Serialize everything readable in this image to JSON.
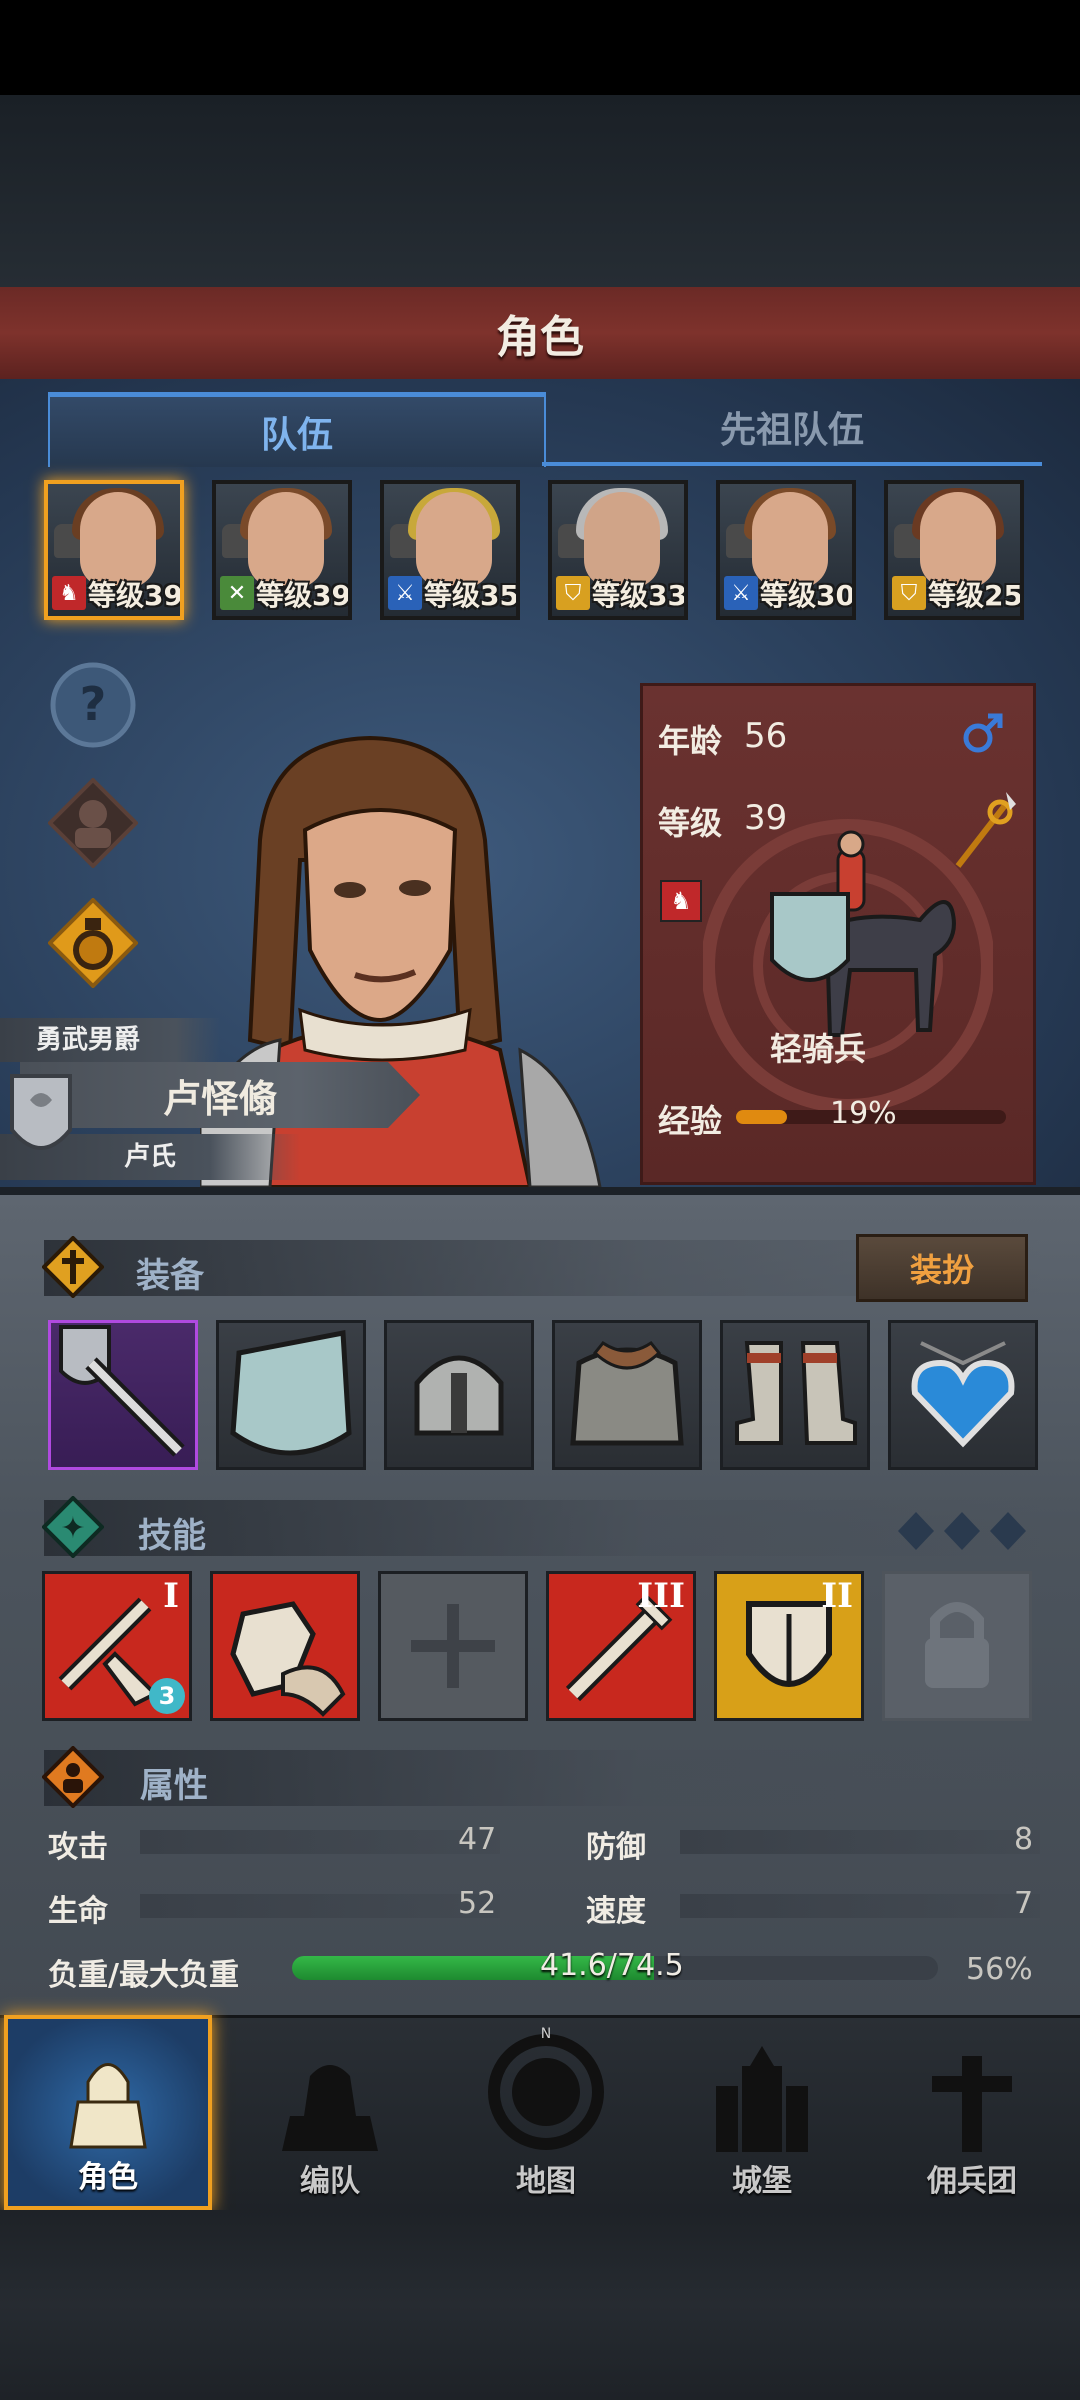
{
  "header": {
    "title": "角色"
  },
  "tabs": [
    {
      "label": "队伍",
      "active": true
    },
    {
      "label": "先祖队伍",
      "active": false
    }
  ],
  "heroes": [
    {
      "level": "等级39",
      "class_icon": "cavalry-icon",
      "badge_color": "#c0282a",
      "hair": "#6a3e22",
      "selected": true
    },
    {
      "level": "等级39",
      "class_icon": "crossed-swords-icon",
      "badge_color": "#4a8a3a",
      "hair": "#7a4a2a",
      "selected": false
    },
    {
      "level": "等级35",
      "class_icon": "sword-icon",
      "badge_color": "#2a62b8",
      "hair": "#c8a83a",
      "selected": false
    },
    {
      "level": "等级33",
      "class_icon": "shield-icon",
      "badge_color": "#d8a020",
      "hair": "#b8b8b8",
      "selected": false
    },
    {
      "level": "等级30",
      "class_icon": "sword-icon",
      "badge_color": "#2a62b8",
      "hair": "#7a4a28",
      "selected": false
    },
    {
      "level": "等级25",
      "class_icon": "shield-icon",
      "badge_color": "#d8a020",
      "hair": "#6a3a22",
      "selected": false
    }
  ],
  "side_buttons": [
    "help-icon",
    "helmet-icon",
    "potion-icon"
  ],
  "character": {
    "title": "勇武男爵",
    "name": "卢怿翛",
    "clan": "卢氏",
    "age_label": "年龄",
    "age": "56",
    "gender_icon": "male-icon",
    "level_label": "等级",
    "level": "39",
    "unit_type": "轻骑兵",
    "exp_label": "经验",
    "exp_percent": "19%",
    "exp_fraction": 0.19
  },
  "equipment": {
    "label": "装备",
    "dress_button": "装扮",
    "slots": [
      "weapon-icon",
      "shield-icon",
      "helmet-icon",
      "armor-icon",
      "boots-icon",
      "amulet-icon"
    ]
  },
  "skills": {
    "label": "技能",
    "items": [
      {
        "icon": "sword-arrow-skill-icon",
        "tier": "I",
        "badge": "3",
        "bg": "#c8281e"
      },
      {
        "icon": "fist-skill-icon",
        "tier": "",
        "badge": "",
        "bg": "#c8281e"
      },
      {
        "icon": "cross-empty-icon",
        "tier": "",
        "badge": "",
        "bg": "#555a60"
      },
      {
        "icon": "sword-skill-icon",
        "tier": "III",
        "badge": "",
        "bg": "#c8281e"
      },
      {
        "icon": "shield-skill-icon",
        "tier": "II",
        "badge": "",
        "bg": "#d8a018"
      },
      {
        "icon": "lock-icon",
        "tier": "",
        "badge": "",
        "bg": "#5a6068"
      }
    ]
  },
  "attributes": {
    "label": "属性",
    "attack_label": "攻击",
    "attack": "47",
    "defense_label": "防御",
    "defense": "8",
    "hp_label": "生命",
    "hp": "52",
    "speed_label": "速度",
    "speed": "7",
    "load_label": "负重/最大负重",
    "load_value": "41.6/74.5",
    "load_percent": "56%",
    "load_fraction": 0.56
  },
  "nav": [
    {
      "label": "角色",
      "icon": "knight-icon",
      "active": true
    },
    {
      "label": "编队",
      "icon": "formation-icon",
      "active": false
    },
    {
      "label": "地图",
      "icon": "compass-icon",
      "active": false
    },
    {
      "label": "城堡",
      "icon": "castle-icon",
      "active": false
    },
    {
      "label": "佣兵团",
      "icon": "mercenary-icon",
      "active": false
    }
  ]
}
